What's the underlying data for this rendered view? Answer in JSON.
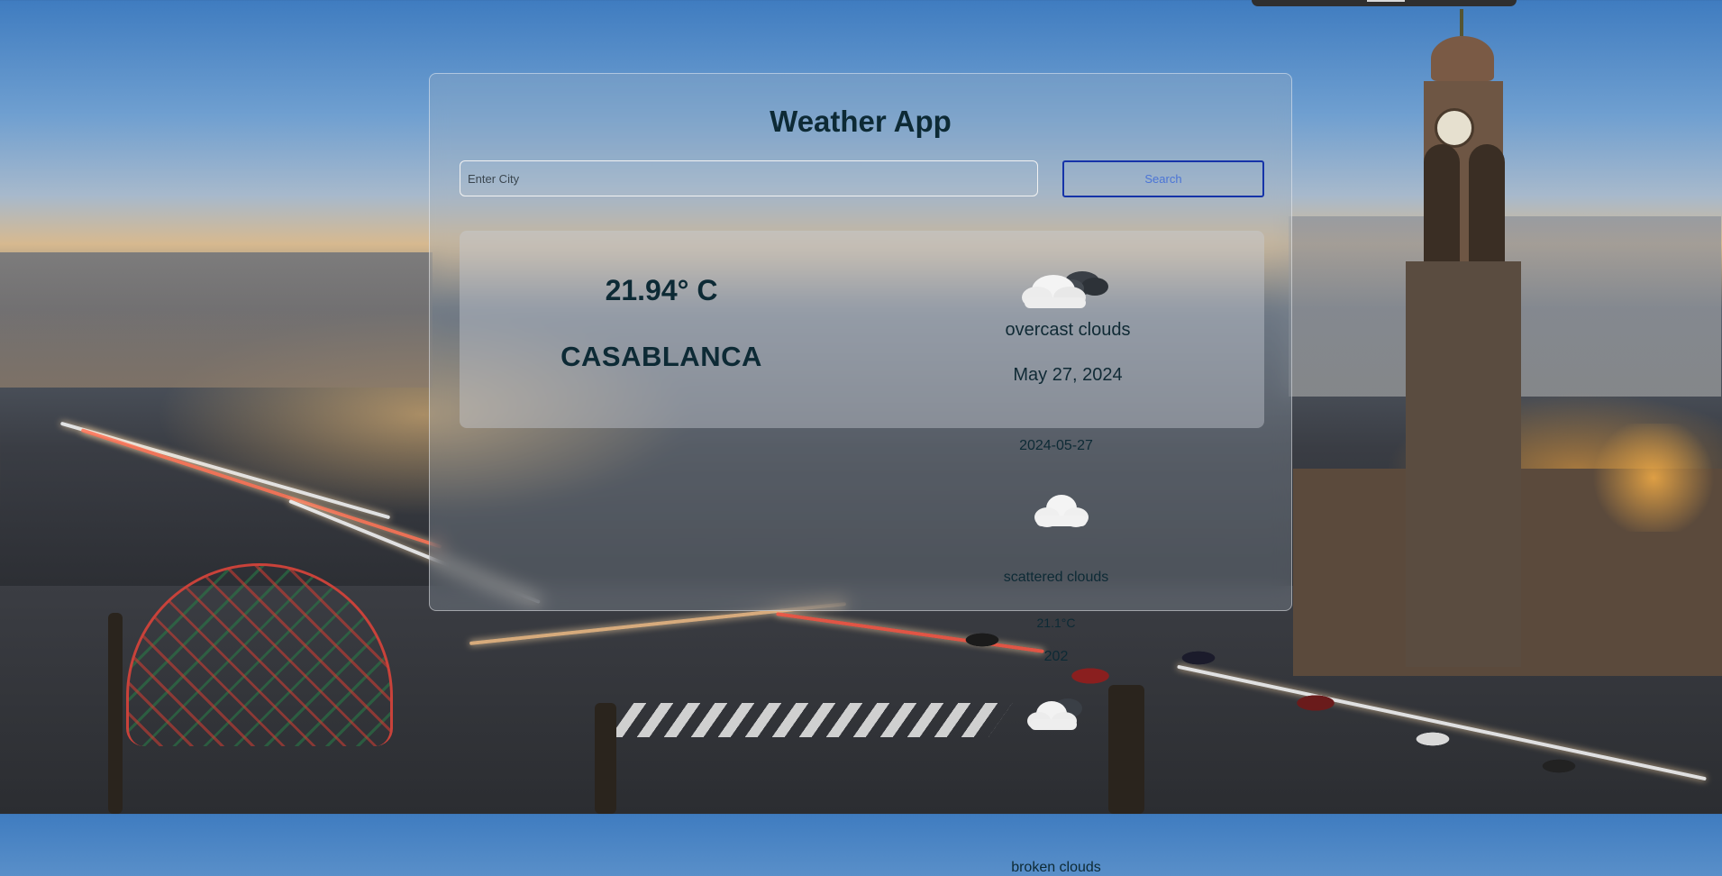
{
  "app": {
    "title": "Weather App"
  },
  "search": {
    "placeholder": "Enter City",
    "value": "",
    "button_label": "Search"
  },
  "current": {
    "temperature": "21.94° C",
    "city": "CASABLANCA",
    "icon": "overcast-clouds-icon",
    "description": "overcast clouds",
    "date": "May 27, 2024"
  },
  "forecast": [
    {
      "date": "2024-05-27",
      "icon": "scattered-clouds-icon",
      "description": "scattered clouds",
      "temperature": "21.1°C"
    },
    {
      "date": "202",
      "icon": "broken-clouds-icon",
      "description": "broken clouds"
    }
  ],
  "colors": {
    "title": "#0d2a35",
    "search_border": "#1533a8",
    "search_text": "#4b74d6"
  }
}
